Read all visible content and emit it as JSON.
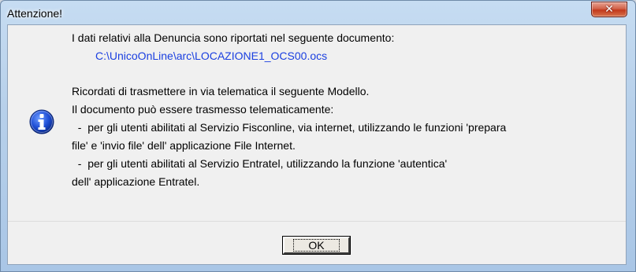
{
  "window": {
    "title": "Attenzione!"
  },
  "message": {
    "line1": "I dati relativi alla Denuncia sono riportati nel seguente documento:",
    "path": "C:\\UnicoOnLine\\arc\\LOCAZIONE1_OCS00.ocs",
    "line3": "Ricordati di trasmettere in via telematica il seguente Modello.",
    "line4": "Il documento può essere trasmesso telematicamente:",
    "line5": "  -  per gli utenti abilitati al Servizio Fisconline, via internet, utilizzando le funzioni 'prepara",
    "line6": "file' e 'invio file' dell' applicazione File Internet.",
    "line7": "  -  per gli utenti abilitati al Servizio Entratel, utilizzando la funzione 'autentica'",
    "line8": "dell' applicazione Entratel."
  },
  "buttons": {
    "ok_label": "OK"
  },
  "icons": {
    "close": "close-icon",
    "info": "information-icon"
  },
  "colors": {
    "path_text": "#1a3fe0",
    "info_icon": "#1f4fd6",
    "close_button": "#c2381c"
  }
}
